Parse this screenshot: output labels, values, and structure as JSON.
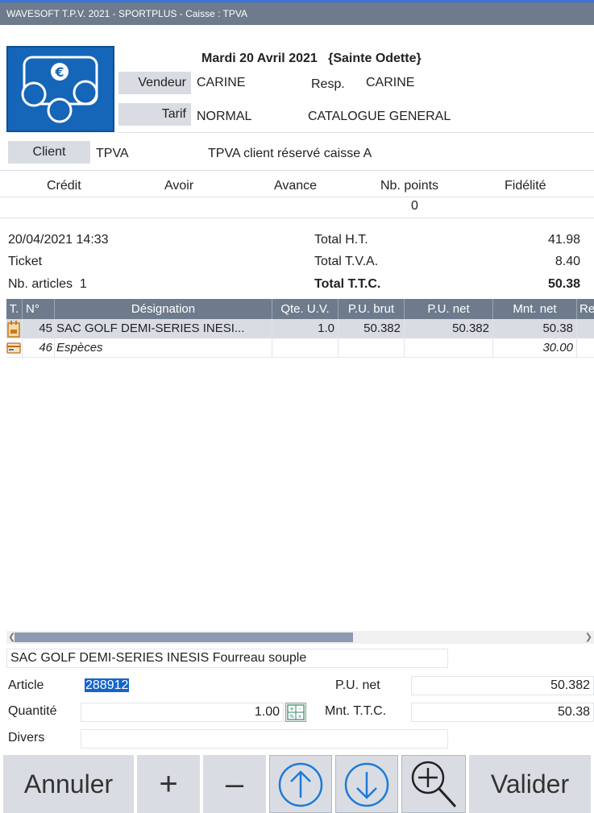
{
  "window": {
    "title": "WAVESOFT T.P.V. 2021 - SPORTPLUS - Caisse : TPVA"
  },
  "header": {
    "date": "Mardi 20 Avril 2021",
    "saint": "{Sainte Odette}",
    "vendeur_label": "Vendeur",
    "vendeur_value": "CARINE",
    "resp_label": "Resp.",
    "resp_value": "CARINE",
    "tarif_label": "Tarif",
    "tarif_value": "NORMAL",
    "catalogue": "CATALOGUE GENERAL"
  },
  "client": {
    "label": "Client",
    "code": "TPVA",
    "name": "TPVA client réservé caisse A"
  },
  "fidelity": {
    "headers": [
      "Crédit",
      "Avoir",
      "Avance",
      "Nb. points",
      "Fidélité"
    ],
    "nb_points": "0"
  },
  "totals": {
    "datetime": "20/04/2021 14:33",
    "doc_type": "Ticket",
    "nb_articles_label": "Nb. articles",
    "nb_articles": "1",
    "ht_label": "Total H.T.",
    "ht_value": "41.98",
    "tva_label": "Total T.V.A.",
    "tva_value": "8.40",
    "ttc_label": "Total T.T.C.",
    "ttc_value": "50.38"
  },
  "grid": {
    "columns": [
      "T.",
      "N°",
      "Désignation",
      "Qte. U.V.",
      "P.U. brut",
      "P.U. net",
      "Mnt. net",
      "Re"
    ],
    "rows": [
      {
        "type_icon": "golf-bag-icon",
        "num": "45",
        "designation": "SAC GOLF DEMI-SERIES INESI...",
        "qte": "1.0",
        "pu_brut": "50.382",
        "pu_net": "50.382",
        "mnt_net": "50.38"
      },
      {
        "type_icon": "cash-payment-icon",
        "num": "46",
        "designation": "Espèces",
        "qte": "",
        "pu_brut": "",
        "pu_net": "",
        "mnt_net": "30.00"
      }
    ]
  },
  "entry": {
    "description": "SAC GOLF DEMI-SERIES INESIS Fourreau souple",
    "article_label": "Article",
    "article_value": "288912",
    "pu_net_label": "P.U. net",
    "pu_net_value": "50.382",
    "quantite_label": "Quantité",
    "quantite_value": "1.00",
    "mnt_ttc_label": "Mnt. T.T.C.",
    "mnt_ttc_value": "50.38",
    "divers_label": "Divers",
    "divers_value": ""
  },
  "buttons": {
    "annuler": "Annuler",
    "plus": "+",
    "minus": "–",
    "valider": "Valider"
  },
  "colors": {
    "titlebar": "#6d7b8c",
    "accent": "#1565b8",
    "panel": "#d9dde3",
    "selection": "#1565c8"
  }
}
